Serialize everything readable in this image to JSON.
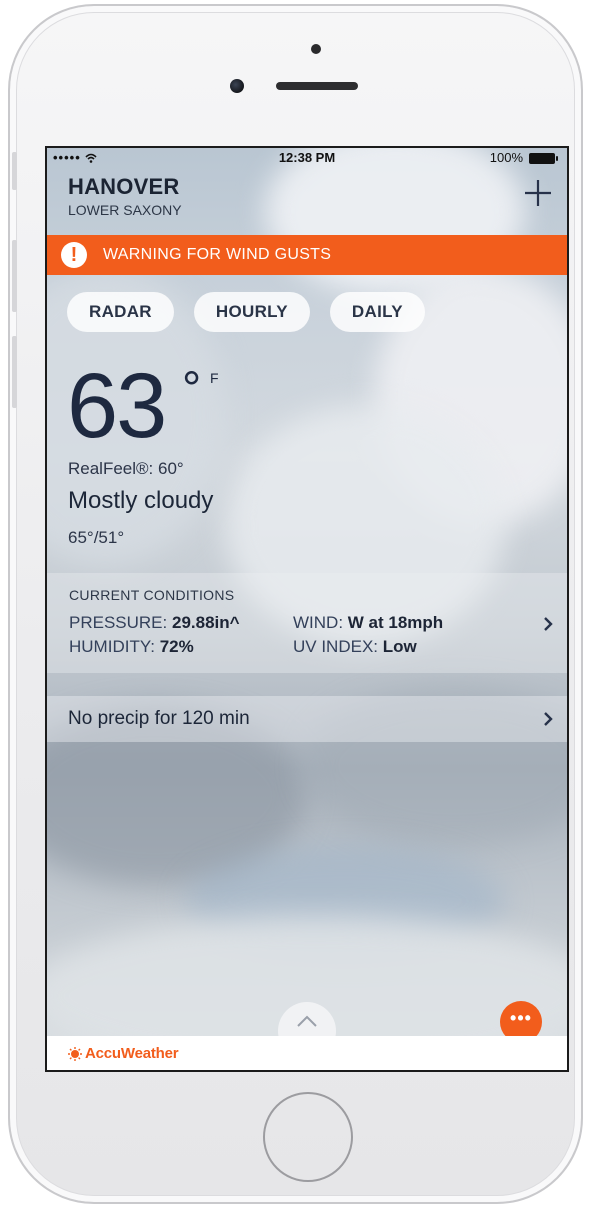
{
  "status_bar": {
    "signal": "•••••",
    "time": "12:38 PM",
    "battery": "100%"
  },
  "location": {
    "city": "HANOVER",
    "region": "LOWER SAXONY",
    "add_label": "+"
  },
  "alert": {
    "icon": "!",
    "text": "WARNING FOR WIND GUSTS"
  },
  "tabs": [
    {
      "label": "RADAR"
    },
    {
      "label": "HOURLY"
    },
    {
      "label": "DAILY"
    }
  ],
  "current": {
    "temperature": "63",
    "unit_degree": "°",
    "unit": "F",
    "realfeel": "RealFeel®: 60°",
    "condition": "Mostly cloudy",
    "hi_lo": "65°/51°"
  },
  "conditions": {
    "title": "CURRENT CONDITIONS",
    "pressure_label": "PRESSURE:",
    "pressure_value": "29.88in^",
    "wind_label": "WIND:",
    "wind_value": "W at 18mph",
    "humidity_label": "HUMIDITY:",
    "humidity_value": "72%",
    "uv_label": "UV INDEX:",
    "uv_value": "Low"
  },
  "precip": {
    "text": "No precip for 120 min"
  },
  "more": {
    "label": "•••"
  },
  "footer": {
    "brand": "AccuWeather"
  },
  "colors": {
    "accent": "#f25d1c",
    "text_dark": "#1e2940"
  },
  "icons": [
    "wifi-icon",
    "battery-icon",
    "plus-icon",
    "alert-icon",
    "chevron-right-icon",
    "chevron-up-icon",
    "more-icon",
    "accuweather-sun-icon"
  ]
}
